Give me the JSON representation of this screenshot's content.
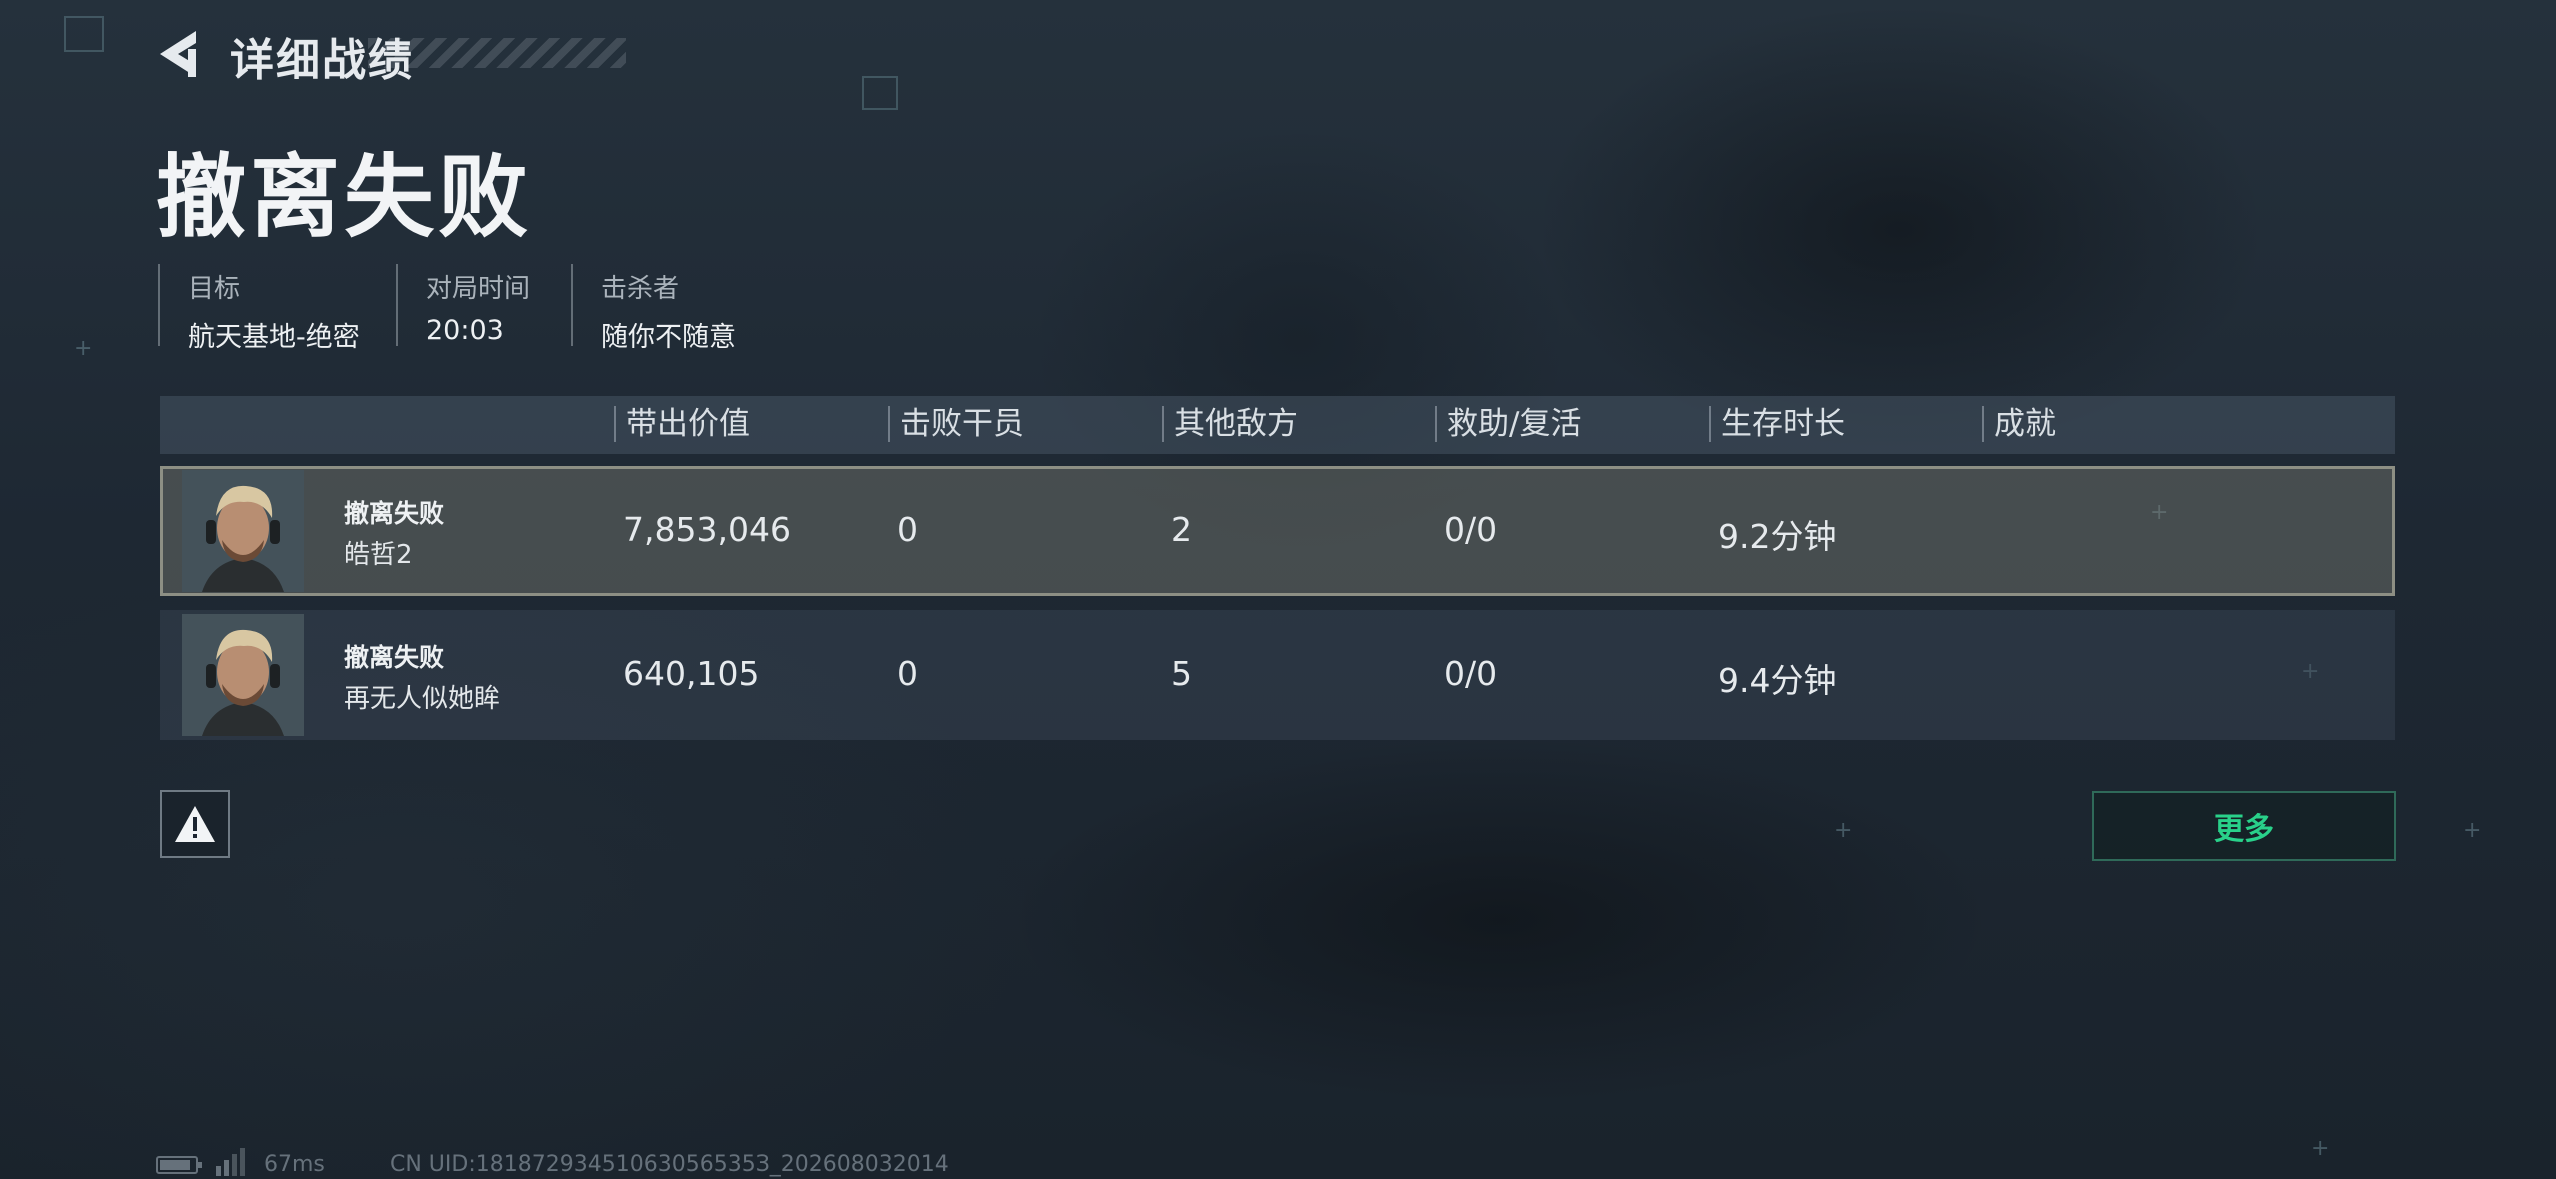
{
  "header": {
    "title": "详细战绩",
    "result_title": "撤离失败"
  },
  "info": [
    {
      "label": "目标",
      "value": "航天基地-绝密"
    },
    {
      "label": "对局时间",
      "value": "20:03"
    },
    {
      "label": "击杀者",
      "value": "随你不随意"
    }
  ],
  "table": {
    "columns": [
      "带出价值",
      "击败干员",
      "其他敌方",
      "救助/复活",
      "生存时长",
      "成就"
    ],
    "rows": [
      {
        "status": "撤离失败",
        "name": "皓哲2",
        "value": "7,853,046",
        "kills": "0",
        "other": "2",
        "assist": "0/0",
        "survival": "9.2分钟",
        "achievement": ""
      },
      {
        "status": "撤离失败",
        "name": "再无人似她眸",
        "value": "640,105",
        "kills": "0",
        "other": "5",
        "assist": "0/0",
        "survival": "9.4分钟",
        "achievement": ""
      }
    ]
  },
  "buttons": {
    "more_label": "更多"
  },
  "footer": {
    "latency": "67ms",
    "uid": "CN UID:18187293451063056535З_202608032014"
  },
  "colors": {
    "accent_green": "#29d18a",
    "selected_row": "#8d8f84"
  }
}
